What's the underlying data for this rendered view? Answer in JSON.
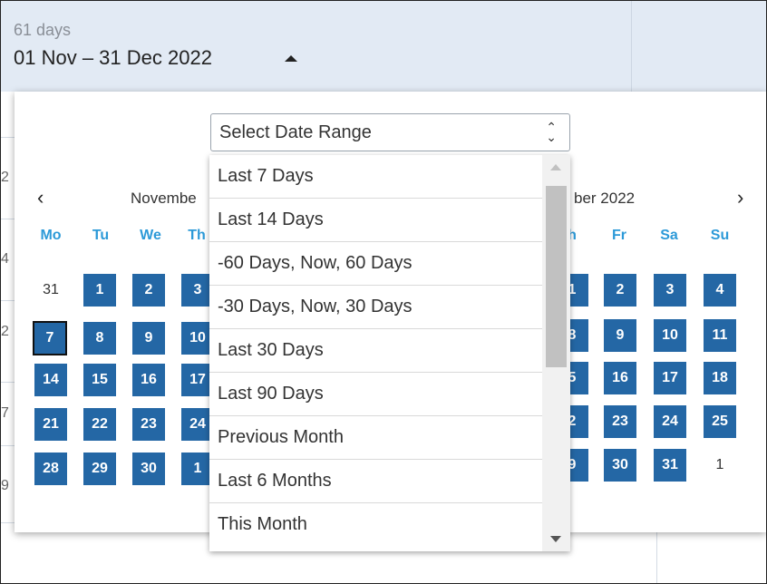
{
  "header": {
    "days_count": "61 days",
    "date_range": "01 Nov – 31 Dec 2022"
  },
  "background_partial_numbers": [
    "2",
    "4",
    "2",
    "7",
    "9"
  ],
  "calendar": {
    "prev_icon": "chevron-left-icon",
    "next_icon": "chevron-right-icon",
    "weekdays": [
      "Mo",
      "Tu",
      "We",
      "Th",
      "Fr",
      "Sa",
      "Su"
    ],
    "left_month": {
      "title_visible": "Novembe",
      "day_headers_visible": [
        "Mo",
        "Tu",
        "We",
        "Th"
      ],
      "rows": [
        [
          "31",
          "1",
          "2",
          "3"
        ],
        [
          "7",
          "8",
          "9",
          "10"
        ],
        [
          "14",
          "15",
          "16",
          "17"
        ],
        [
          "21",
          "22",
          "23",
          "24"
        ],
        [
          "28",
          "29",
          "30",
          "1"
        ]
      ],
      "today": "7"
    },
    "right_month": {
      "title_visible": "ber 2022",
      "day_headers_visible": [
        "h",
        "Fr",
        "Sa",
        "Su"
      ],
      "rows": [
        [
          "1",
          "2",
          "3",
          "4"
        ],
        [
          "8",
          "9",
          "10",
          "11"
        ],
        [
          "5",
          "16",
          "17",
          "18"
        ],
        [
          "2",
          "23",
          "24",
          "25"
        ],
        [
          "9",
          "30",
          "31",
          "1"
        ]
      ]
    }
  },
  "range_select": {
    "label": "Select Date Range",
    "options": [
      "Last 7 Days",
      "Last 14 Days",
      "-60 Days, Now, 60 Days",
      "-30 Days, Now, 30 Days",
      "Last 30 Days",
      "Last 90 Days",
      "Previous Month",
      "Last 6 Months",
      "This Month"
    ]
  },
  "colors": {
    "header_bg": "#e2eaf4",
    "selected_day": "#2467a5",
    "weekday_header": "#2d9ad8"
  }
}
